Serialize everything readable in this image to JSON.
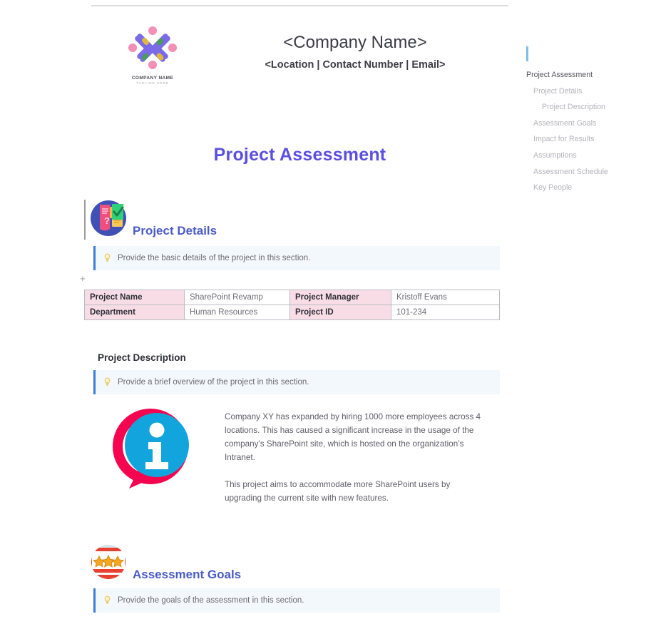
{
  "letterhead": {
    "logo": {
      "icon": "company-pinwheel-logo",
      "name": "COMPANY NAME",
      "tagline": "TAGLINE HERE"
    },
    "company_name": "<Company Name>",
    "contact_line": "<Location | Contact Number | Email>"
  },
  "document": {
    "title": "Project Assessment"
  },
  "sections": {
    "project_details": {
      "icon": "project-details-shield-icon",
      "title": "Project Details",
      "hint": "Provide the basic details of the project in this section.",
      "add_handle": "+",
      "table": {
        "rows": [
          {
            "label_1": "Project Name",
            "value_1": "SharePoint Revamp",
            "label_2": "Project Manager",
            "value_2": "Kristoff Evans"
          },
          {
            "label_1": "Department",
            "value_1": "Human Resources",
            "label_2": "Project ID",
            "value_2": "101-234"
          }
        ]
      }
    },
    "project_description": {
      "title": "Project Description",
      "hint": "Provide a brief overview of the project in this section.",
      "icon": "information-bubble-icon",
      "paragraph_1": "Company XY has expanded by hiring 1000 more employees across 4 locations. This has caused a significant increase in the usage of the company’s SharePoint site, which is hosted on the organization’s Intranet.",
      "paragraph_2": "This project aims to accommodate more SharePoint users by upgrading the current site with new features."
    },
    "assessment_goals": {
      "icon": "three-stars-badge-icon",
      "title": "Assessment Goals",
      "hint": "Provide the goals of the assessment in this section."
    }
  },
  "navigation": {
    "items": [
      {
        "label": "Project Assessment",
        "level": 0
      },
      {
        "label": "Project Details",
        "level": 1
      },
      {
        "label": "Project Description",
        "level": 2
      },
      {
        "label": "Assessment Goals",
        "level": 1
      },
      {
        "label": "Impact for Results",
        "level": 1
      },
      {
        "label": "Assumptions",
        "level": 1
      },
      {
        "label": "Assessment Schedule",
        "level": 1
      },
      {
        "label": "Key People",
        "level": 1
      }
    ]
  },
  "colors": {
    "title_purple": "#5b4fe3",
    "section_heading_blue": "#4b5bc4",
    "hint_background": "#f3f8fd",
    "hint_border": "#3b7dd8",
    "table_label_pink": "#f8dde6",
    "nav_caret_blue": "#7cc0ea"
  }
}
